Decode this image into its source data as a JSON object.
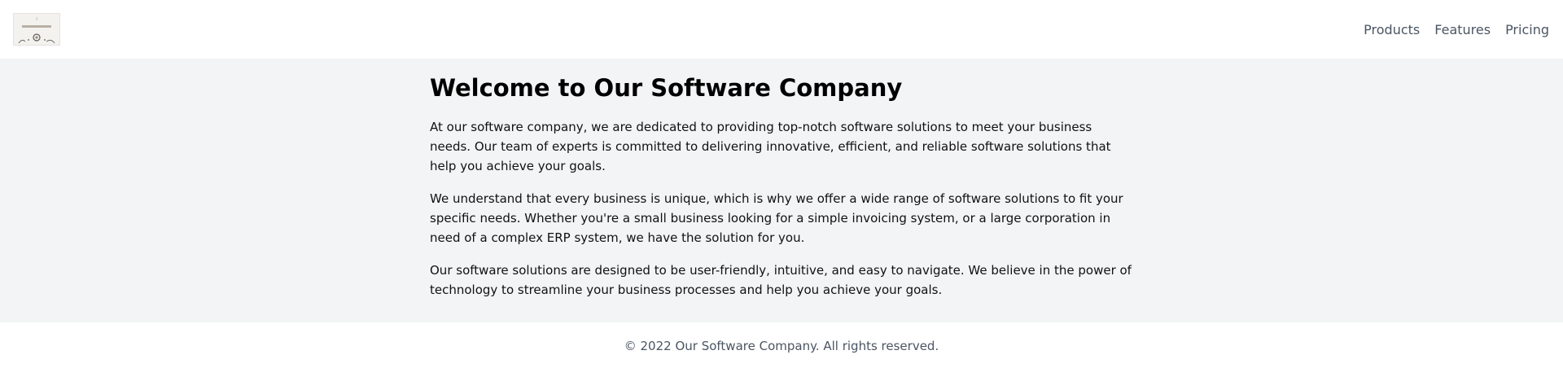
{
  "header": {
    "logo_name": "company-logo",
    "nav": [
      {
        "label": "Products"
      },
      {
        "label": "Features"
      },
      {
        "label": "Pricing"
      }
    ]
  },
  "main": {
    "title": "Welcome to Our Software Company",
    "paragraphs": [
      "At our software company, we are dedicated to providing top-notch software solutions to meet your business needs. Our team of experts is committed to delivering innovative, efficient, and reliable software solutions that help you achieve your goals.",
      "We understand that every business is unique, which is why we offer a wide range of software solutions to fit your specific needs. Whether you're a small business looking for a simple invoicing system, or a large corporation in need of a complex ERP system, we have the solution for you.",
      "Our software solutions are designed to be user-friendly, intuitive, and easy to navigate. We believe in the power of technology to streamline your business processes and help you achieve your goals."
    ]
  },
  "footer": {
    "copyright": "© 2022 Our Software Company. All rights reserved."
  },
  "colors": {
    "header_bg": "#ffffff",
    "main_bg": "#f3f4f6",
    "nav_text": "#4b5563",
    "body_text": "#111111"
  }
}
